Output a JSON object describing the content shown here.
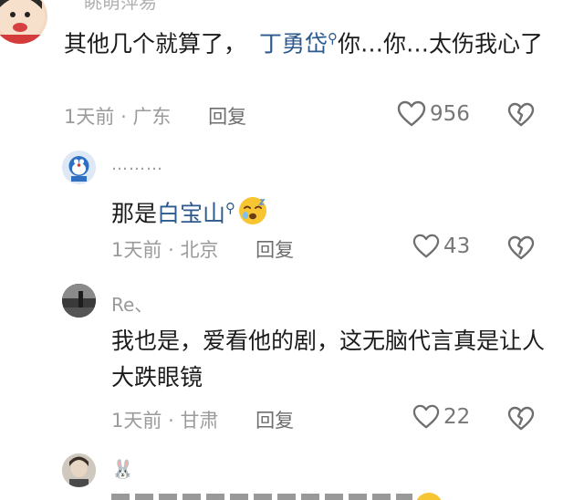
{
  "comments": [
    {
      "username": "眺萌萍易",
      "text_before": "其他几个就算了，",
      "mention": "丁勇岱",
      "text_after": "你…你…太伤我心了",
      "time": "1天前",
      "location": "广东",
      "reply_label": "回复",
      "likes": "956"
    }
  ],
  "replies": [
    {
      "username": "………",
      "text_before": "那是",
      "mention": "白宝山",
      "emoji": "sleepy-face",
      "time": "1天前",
      "location": "北京",
      "reply_label": "回复",
      "likes": "43"
    },
    {
      "username": "Re、",
      "text": "我也是，爱看他的剧，这无脑代言真是让人大跌眼镜",
      "time": "1天前",
      "location": "甘肃",
      "reply_label": "回复",
      "likes": "22"
    },
    {
      "username": "🐰"
    }
  ],
  "meta_separator": "·",
  "colors": {
    "mention": "#2d5a8c",
    "meta": "#9b9b9b",
    "text": "#1c1c1c"
  }
}
